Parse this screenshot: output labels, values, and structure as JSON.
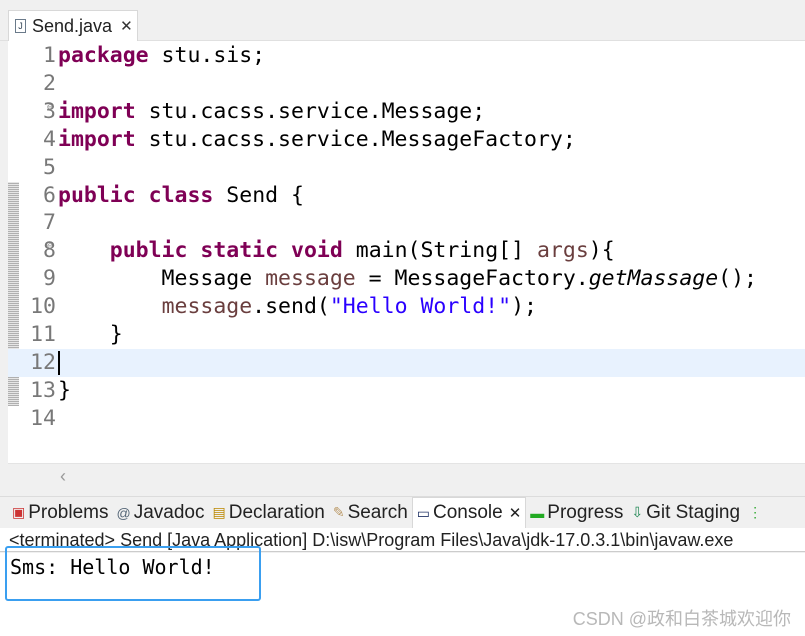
{
  "editor_tab": {
    "title": "Send.java",
    "icon": "java-file-icon"
  },
  "code_lines": [
    {
      "n": "1"
    },
    {
      "n": "2"
    },
    {
      "n": "3"
    },
    {
      "n": "4"
    },
    {
      "n": "5"
    },
    {
      "n": "6"
    },
    {
      "n": "7"
    },
    {
      "n": "8"
    },
    {
      "n": "9"
    },
    {
      "n": "10"
    },
    {
      "n": "11"
    },
    {
      "n": "12"
    },
    {
      "n": "13"
    },
    {
      "n": "14"
    }
  ],
  "code": {
    "l1": [
      "package",
      " stu.sis;"
    ],
    "l3": [
      "import",
      " stu.cacss.service.Message;"
    ],
    "l4": [
      "import",
      " stu.cacss.service.MessageFactory;"
    ],
    "l6": [
      "public",
      " ",
      "class",
      " Send {"
    ],
    "l8": [
      "    ",
      "public",
      " ",
      "static",
      " ",
      "void",
      " main(String[] ",
      "args",
      "){"
    ],
    "l9": [
      "        Message ",
      "message",
      " = MessageFactory.",
      "getMassage",
      "();"
    ],
    "l10": [
      "        ",
      "message",
      ".send(",
      "\"Hello World!\"",
      ");"
    ],
    "l11": "    }",
    "l13": "}"
  },
  "panel_tabs": [
    {
      "label": "Problems",
      "icon": "problems-icon"
    },
    {
      "label": "Javadoc",
      "icon": "at-icon"
    },
    {
      "label": "Declaration",
      "icon": "declaration-icon"
    },
    {
      "label": "Search",
      "icon": "search-flashlight-icon"
    },
    {
      "label": "Console",
      "icon": "console-icon",
      "active": true
    },
    {
      "label": "Progress",
      "icon": "progress-icon"
    },
    {
      "label": "Git Staging",
      "icon": "git-staging-icon"
    }
  ],
  "console": {
    "status": "<terminated> Send [Java Application] D:\\isw\\Program Files\\Java\\jdk-17.0.3.1\\bin\\javaw.exe",
    "output": "Sms: Hello World!"
  },
  "watermark": "CSDN @政和白茶城欢迎你",
  "colors": {
    "keyword": "#7f0055",
    "string": "#2a00ff",
    "highlight_box": "#3a9ff0",
    "current_line": "#e8f2fe"
  }
}
